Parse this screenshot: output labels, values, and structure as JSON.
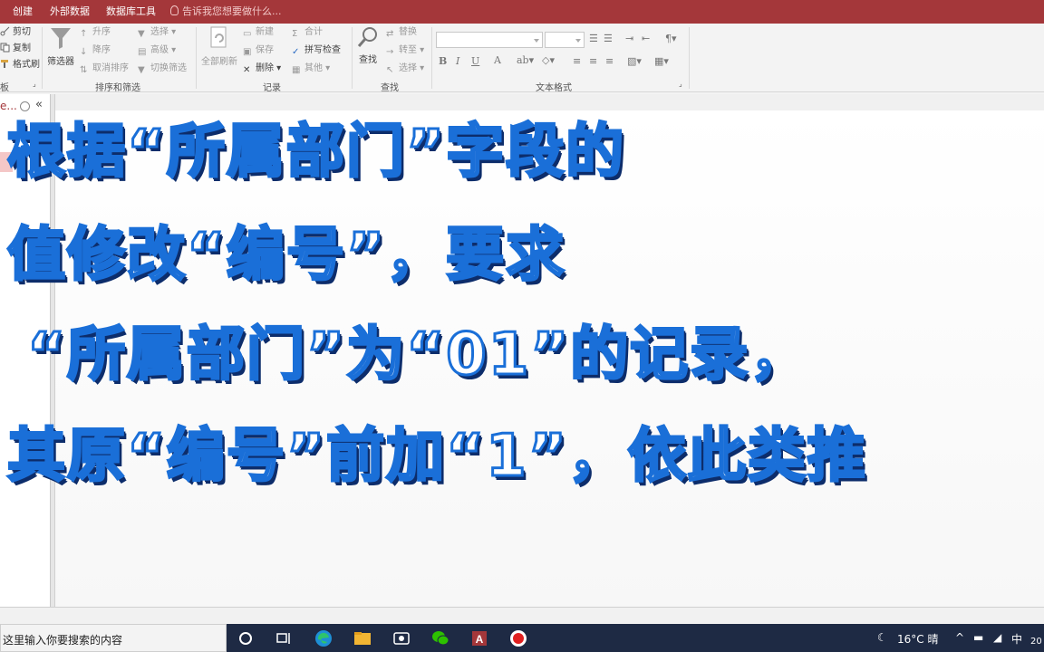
{
  "ribbon_tabs": [
    "创建",
    "外部数据",
    "数据库工具"
  ],
  "tell_me": "告诉我您想要做什么...",
  "clipboard": {
    "cut": "剪切",
    "copy": "复制",
    "format_painter": "格式刷",
    "group_label": "板"
  },
  "sort_filter": {
    "filter": "筛选器",
    "ascending": "升序",
    "descending": "降序",
    "clear_sort": "取消排序",
    "selection": "选择",
    "advanced": "高级",
    "toggle_filter": "切换筛选",
    "group_label": "排序和筛选"
  },
  "records": {
    "refresh_all": "全部刷新",
    "new": "新建",
    "save": "保存",
    "delete": "删除",
    "totals": "合计",
    "spelling": "拼写检查",
    "more": "其他",
    "group_label": "记录"
  },
  "find": {
    "find": "查找",
    "replace": "替换",
    "goto": "转至",
    "select": "选择",
    "group_label": "查找"
  },
  "text_format": {
    "bold": "B",
    "italic": "I",
    "underline": "U",
    "font_color": "A",
    "group_label": "文本格式"
  },
  "nav_pane": {
    "title": "e...",
    "collapse": "«"
  },
  "caption": {
    "line1": "根据“所属部门”字段的",
    "line2": "值修改“编号”，要求",
    "line3": "“所属部门”为“01”的记录，",
    "line4": "其原“编号”前加“1”，依此类推"
  },
  "taskbar": {
    "search_placeholder": "这里输入你要搜索的内容",
    "temperature": "16°C 晴",
    "ime": "中",
    "clock_fragment": "20"
  },
  "colors": {
    "access_red": "#a4373a",
    "caption_blue": "#1a6fd8",
    "taskbar": "#1e2a44"
  }
}
